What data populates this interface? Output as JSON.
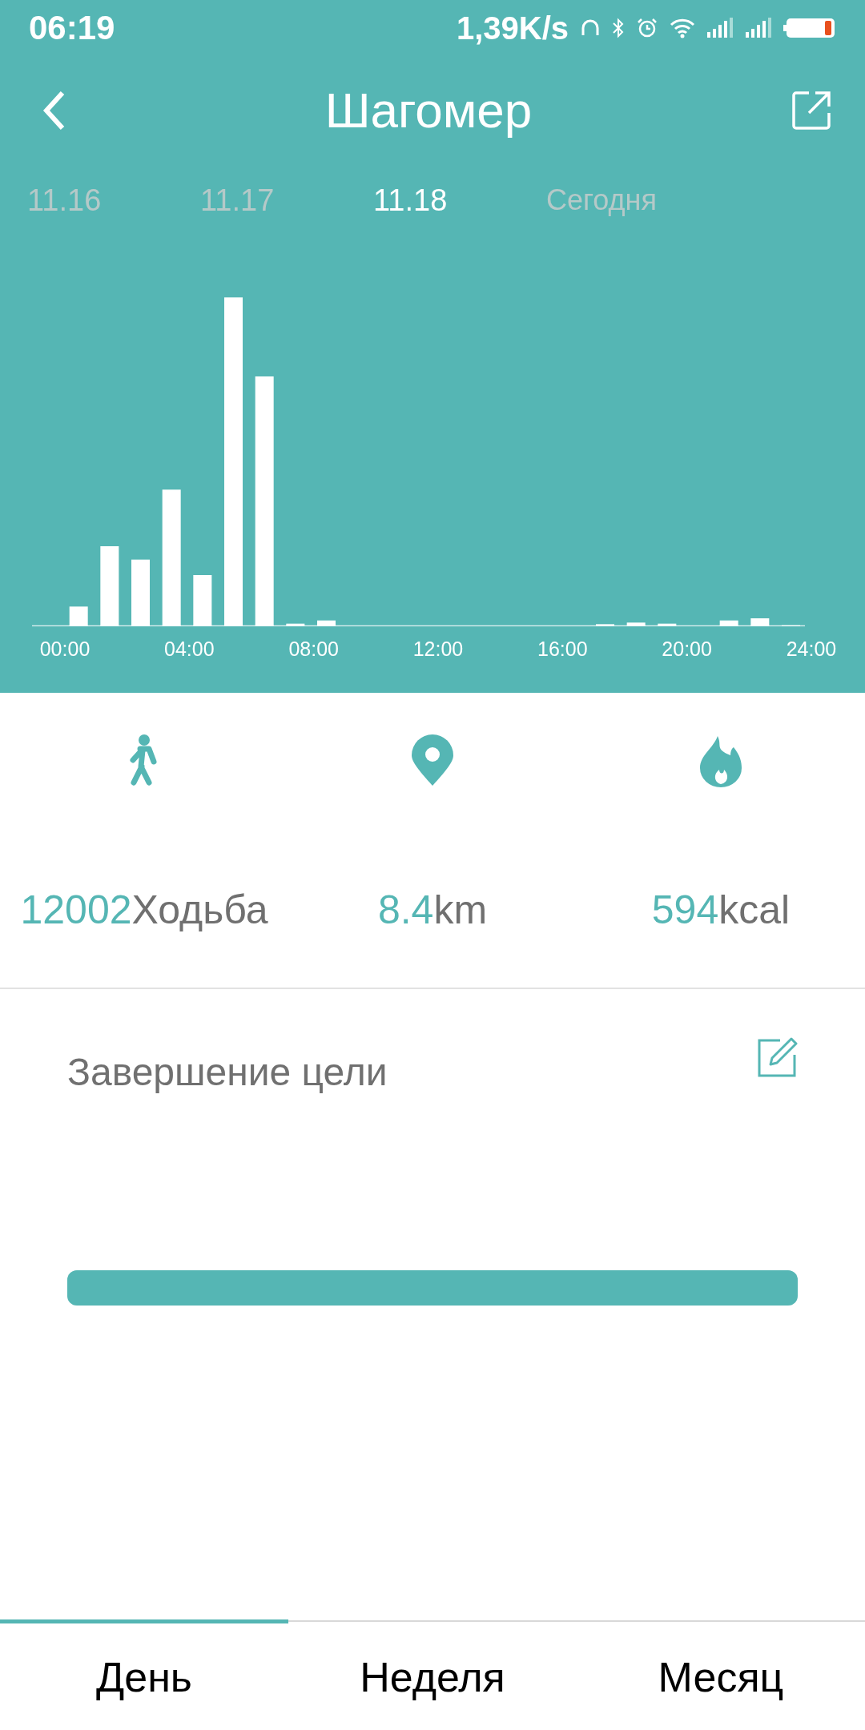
{
  "status_bar": {
    "time": "06:19",
    "speed": "1,39K/s"
  },
  "header": {
    "title": "Шагомер"
  },
  "dates": [
    {
      "label": "11.16",
      "selected": false
    },
    {
      "label": "11.17",
      "selected": false
    },
    {
      "label": "11.18",
      "selected": true
    },
    {
      "label": "Сегодня",
      "selected": false
    }
  ],
  "chart": {
    "x_labels": [
      "00:00",
      "04:00",
      "08:00",
      "12:00",
      "16:00",
      "20:00",
      "24:00"
    ]
  },
  "stats": [
    {
      "kind": "steps",
      "value": "12002",
      "unit": "Ходьба"
    },
    {
      "kind": "distance",
      "value": "8.4",
      "unit": "km"
    },
    {
      "kind": "calories",
      "value": "594",
      "unit": "kcal"
    }
  ],
  "goal": {
    "title": "Завершение цели",
    "level": 1
  },
  "tabs": [
    {
      "label": "День",
      "selected": true
    },
    {
      "label": "Неделя",
      "selected": false
    },
    {
      "label": "Месяц",
      "selected": false
    }
  ]
}
